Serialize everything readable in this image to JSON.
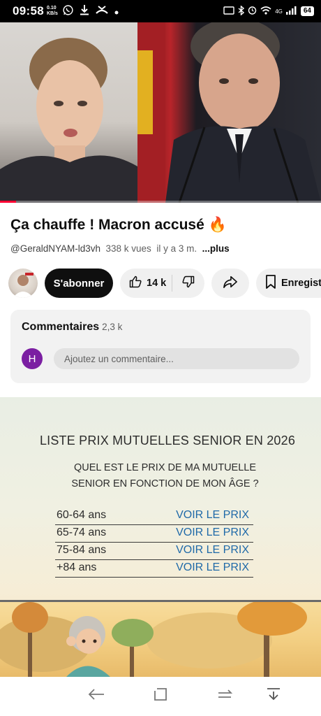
{
  "status_bar": {
    "time": "09:58",
    "speed_value": "0.10",
    "speed_unit": "KB/s",
    "network": "4G",
    "battery": "64"
  },
  "video": {
    "progress": 0.05,
    "progress_color": "#ff0033"
  },
  "title": "Ça chauffe ! Macron accusé 🔥",
  "meta": {
    "channel": "@GeraldNYAM-ld3vh",
    "views": "338 k vues",
    "age": "il y a 3 m.",
    "more": "...plus"
  },
  "actions": {
    "subscribe": "S'abonner",
    "likes": "14 k",
    "save": "Enregistrer"
  },
  "comments": {
    "heading": "Commentaires",
    "count": "2,3 k",
    "avatar_letter": "H",
    "avatar_color": "#7b1fa2",
    "placeholder": "Ajoutez un commentaire..."
  },
  "ad": {
    "title": "LISTE PRIX MUTUELLES SENIOR EN 2026",
    "subtitle_line1": "QUEL EST LE PRIX DE MA MUTUELLE",
    "subtitle_line2": "SENIOR EN FONCTION DE MON ÂGE ?",
    "link_color": "#1f69a8",
    "rows": [
      {
        "age": "60-64 ans",
        "link": "VOIR LE PRIX"
      },
      {
        "age": "65-74 ans",
        "link": "VOIR LE PRIX"
      },
      {
        "age": "75-84 ans",
        "link": "VOIR LE PRIX"
      },
      {
        "age": "+84 ans",
        "link": "VOIR LE PRIX"
      }
    ]
  },
  "nav": {
    "icons": [
      "back-icon",
      "home-icon",
      "recents-icon",
      "keyboard-hide-icon"
    ]
  }
}
